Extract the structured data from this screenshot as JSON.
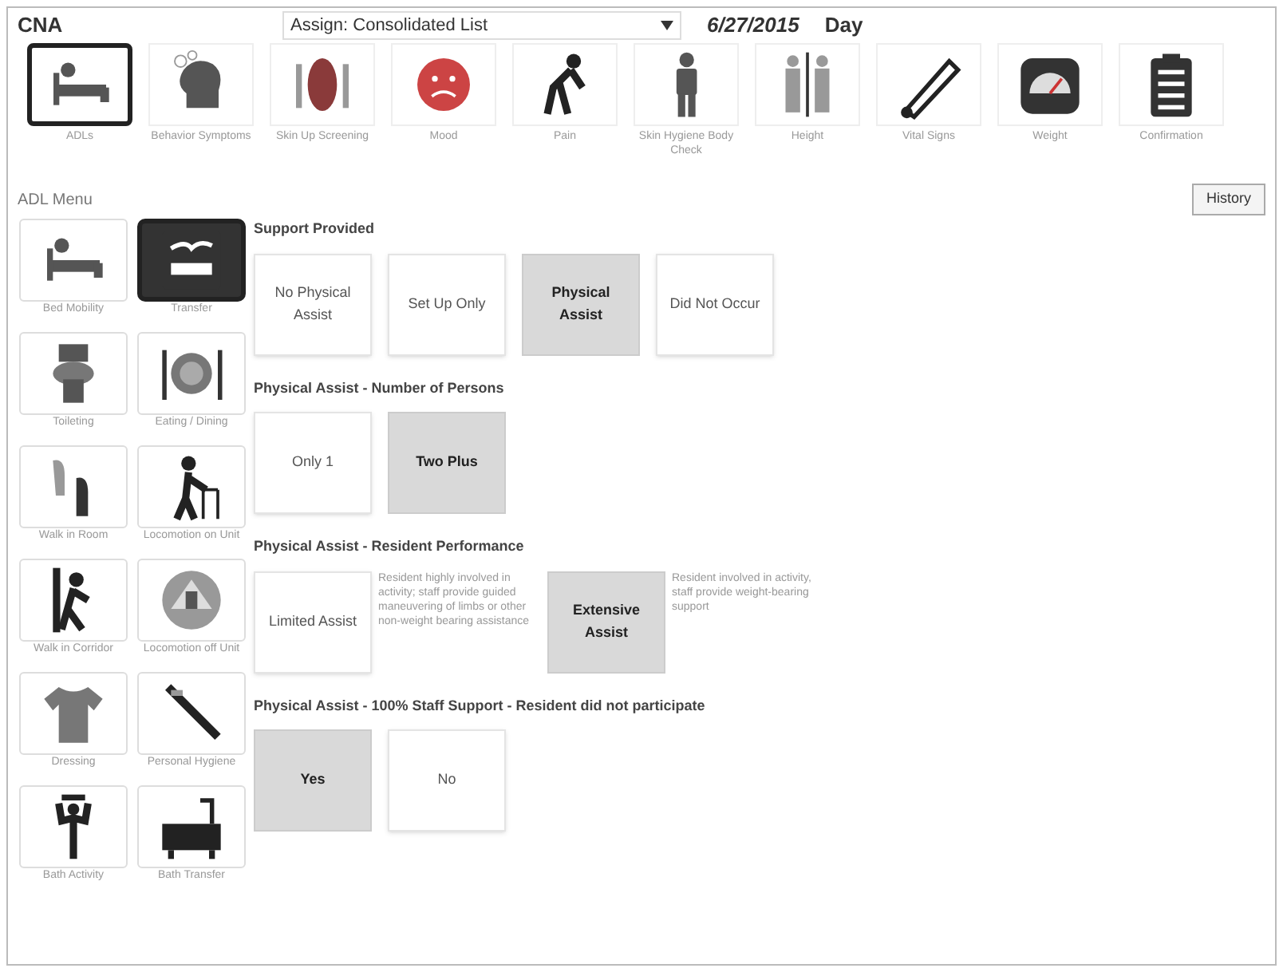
{
  "header": {
    "title": "CNA",
    "assignment": "Assign: Consolidated List",
    "date": "6/27/2015",
    "shift": "Day"
  },
  "tasks": [
    {
      "label": "ADLs",
      "selected": true
    },
    {
      "label": "Behavior Symptoms",
      "selected": false
    },
    {
      "label": "Skin Up Screening",
      "selected": false
    },
    {
      "label": "Mood",
      "selected": false
    },
    {
      "label": "Pain",
      "selected": false
    },
    {
      "label": "Skin Hygiene Body Check",
      "selected": false
    },
    {
      "label": "Height",
      "selected": false
    },
    {
      "label": "Vital Signs",
      "selected": false
    },
    {
      "label": "Weight",
      "selected": false
    },
    {
      "label": "Confirmation",
      "selected": false
    }
  ],
  "adl_menu": {
    "title": "ADL Menu",
    "history_button": "History",
    "items": [
      {
        "label": "Bed Mobility",
        "selected": false
      },
      {
        "label": "Transfer",
        "selected": true
      },
      {
        "label": "Toileting",
        "selected": false
      },
      {
        "label": "Eating / Dining",
        "selected": false
      },
      {
        "label": "Walk in Room",
        "selected": false
      },
      {
        "label": "Locomotion on Unit",
        "selected": false
      },
      {
        "label": "Walk in Corridor",
        "selected": false
      },
      {
        "label": "Locomotion off Unit",
        "selected": false
      },
      {
        "label": "Dressing",
        "selected": false
      },
      {
        "label": "Personal Hygiene",
        "selected": false
      },
      {
        "label": "Bath Activity",
        "selected": false
      },
      {
        "label": "Bath Transfer",
        "selected": false
      }
    ]
  },
  "sections": [
    {
      "title": "Support Provided",
      "options": [
        {
          "label": "No Physical Assist",
          "selected": false
        },
        {
          "label": "Set Up Only",
          "selected": false
        },
        {
          "label": "Physical Assist",
          "selected": true
        },
        {
          "label": "Did Not Occur",
          "selected": false
        }
      ]
    },
    {
      "title": "Physical Assist - Number of Persons",
      "options": [
        {
          "label": "Only 1",
          "selected": false
        },
        {
          "label": "Two Plus",
          "selected": true
        }
      ]
    },
    {
      "title": "Physical Assist - Resident Performance",
      "options": [
        {
          "label": "Limited Assist",
          "selected": false,
          "description": "Resident highly involved in activity; staff provide guided maneuvering of limbs or other non-weight bearing assistance"
        },
        {
          "label": "Extensive Assist",
          "selected": true,
          "description": "Resident involved in activity, staff provide weight-bearing support"
        }
      ]
    },
    {
      "title": "Physical Assist - 100% Staff Support - Resident did not participate",
      "options": [
        {
          "label": "Yes",
          "selected": true
        },
        {
          "label": "No",
          "selected": false
        }
      ]
    }
  ]
}
